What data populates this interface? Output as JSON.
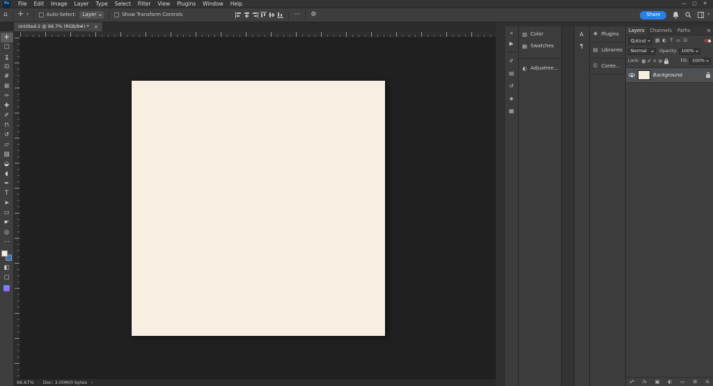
{
  "colors": {
    "accent": "#2680eb",
    "doc_fill": "#f7efe1",
    "fg_swatch": "#f7efe1",
    "bg_swatch": "#3e6db5",
    "ps_logo_bg": "#0b2a45",
    "ps_logo_text": "#55b1f5"
  },
  "menubar": {
    "logo": "Ps",
    "items": [
      "File",
      "Edit",
      "Image",
      "Layer",
      "Type",
      "Select",
      "Filter",
      "View",
      "Plugins",
      "Window",
      "Help"
    ],
    "window_controls": {
      "minimize": "—",
      "maximize": "▢",
      "close": "✕"
    }
  },
  "options_bar": {
    "home_icon": "⌂",
    "move_icon": "✛",
    "caret_icon": "▾",
    "auto_select_label": "Auto-Select:",
    "auto_select_value": "Layer",
    "show_transform_label": "Show Transform Controls",
    "ellipsis_icon": "⋯",
    "gear_icon": "⚙",
    "share_label": "Share",
    "align_icons": [
      {
        "name": "align-left-icon",
        "cls": "al-left"
      },
      {
        "name": "align-center-horizontal-icon",
        "cls": "al-ch"
      },
      {
        "name": "align-right-icon",
        "cls": "al-right"
      },
      {
        "name": "align-top-icon",
        "cls": "al-top"
      },
      {
        "name": "align-middle-vertical-icon",
        "cls": "al-mv"
      },
      {
        "name": "align-bottom-icon",
        "cls": "al-bottom"
      }
    ]
  },
  "document_tab": {
    "title": "Untitled-2 @ 66.7% (RGB/8#) *",
    "close_icon": "×"
  },
  "toolbar": {
    "tools": [
      {
        "name": "move-tool",
        "glyph": "✛",
        "active": true
      },
      {
        "name": "rectangular-marquee-tool",
        "glyph": "☐"
      },
      {
        "name": "lasso-tool",
        "glyph": "ʓ"
      },
      {
        "name": "object-selection-tool",
        "glyph": "⊡"
      },
      {
        "name": "crop-tool",
        "glyph": "#"
      },
      {
        "name": "frame-tool",
        "glyph": "⊠"
      },
      {
        "name": "eyedropper-tool",
        "glyph": "✑"
      },
      {
        "name": "spot-healing-brush-tool",
        "glyph": "✚"
      },
      {
        "name": "brush-tool",
        "glyph": "✐"
      },
      {
        "name": "clone-stamp-tool",
        "glyph": "⊓"
      },
      {
        "name": "history-brush-tool",
        "glyph": "↺"
      },
      {
        "name": "eraser-tool",
        "glyph": "▱"
      },
      {
        "name": "gradient-tool",
        "glyph": "▨"
      },
      {
        "name": "blur-tool",
        "glyph": "◒"
      },
      {
        "name": "dodge-tool",
        "glyph": "◖"
      },
      {
        "name": "pen-tool",
        "glyph": "✒"
      },
      {
        "name": "type-tool",
        "glyph": "T"
      },
      {
        "name": "path-selection-tool",
        "glyph": "➤"
      },
      {
        "name": "rectangle-tool",
        "glyph": "▭"
      },
      {
        "name": "hand-tool",
        "glyph": "☛"
      },
      {
        "name": "zoom-tool",
        "glyph": "◎"
      },
      {
        "name": "edit-toolbar-button",
        "glyph": "⋯"
      }
    ],
    "bottom_tools": [
      {
        "name": "quick-mask-button",
        "glyph": "◧"
      },
      {
        "name": "screen-mode-button",
        "glyph": "▢"
      }
    ]
  },
  "right_dock": {
    "strip_top": [
      {
        "name": "collapse-dock-icon",
        "glyph": "«"
      },
      {
        "name": "actions-panel-icon",
        "glyph": "▶"
      }
    ],
    "strip_group": [
      {
        "name": "brush-settings-panel-icon",
        "glyph": "✐"
      },
      {
        "name": "info-panel-icon",
        "glyph": "▤"
      },
      {
        "name": "history-panel-icon",
        "glyph": "↺"
      },
      {
        "name": "navigator-panel-icon",
        "glyph": "◈"
      },
      {
        "name": "timeline-panel-icon",
        "glyph": "▦"
      }
    ],
    "color_group": [
      {
        "name": "color-panel-button",
        "glyph": "▧",
        "label": "Color"
      },
      {
        "name": "swatches-panel-button",
        "glyph": "▦",
        "label": "Swatches"
      }
    ],
    "adjust_group": [
      {
        "name": "adjustments-panel-button",
        "glyph": "◐",
        "label": "Adjustme..."
      }
    ],
    "type_strip": [
      {
        "name": "character-panel-icon",
        "glyph": "A"
      },
      {
        "name": "paragraph-panel-icon",
        "glyph": "¶"
      }
    ],
    "library_group": [
      {
        "name": "plugins-panel-button",
        "glyph": "❖",
        "label": "Plugins"
      },
      {
        "name": "libraries-panel-button",
        "glyph": "▤",
        "label": "Libraries"
      },
      {
        "name": "content-credentials-panel-button",
        "glyph": "©",
        "label": "Conte..."
      }
    ]
  },
  "layers_panel": {
    "tabs": [
      {
        "name": "tab-layers",
        "label": "Layers",
        "active": true
      },
      {
        "name": "tab-channels",
        "label": "Channels"
      },
      {
        "name": "tab-paths",
        "label": "Paths"
      }
    ],
    "panel_menu_icon": "≡",
    "filter": {
      "kind_label": "Kind",
      "icons": [
        {
          "name": "filter-pixel-layers-icon",
          "glyph": "▦"
        },
        {
          "name": "filter-adjustment-layers-icon",
          "glyph": "◐"
        },
        {
          "name": "filter-type-layers-icon",
          "glyph": "T"
        },
        {
          "name": "filter-shape-layers-icon",
          "glyph": "▭"
        },
        {
          "name": "filter-smart-objects-icon",
          "glyph": "⊡"
        }
      ]
    },
    "blend_mode": "Normal",
    "opacity_label": "Opacity:",
    "opacity_value": "100%",
    "lock_label": "Lock:",
    "lock_icons": [
      {
        "name": "lock-transparency-icon",
        "glyph": "▦"
      },
      {
        "name": "lock-pixels-icon",
        "glyph": "✐"
      },
      {
        "name": "lock-position-icon",
        "glyph": "✛"
      },
      {
        "name": "lock-artboard-icon",
        "glyph": "⊞"
      }
    ],
    "fill_label": "Fill:",
    "fill_value": "100%",
    "layers": [
      {
        "name": "Background"
      }
    ],
    "bottom_icons": [
      {
        "name": "link-layers-icon",
        "glyph": "☍"
      },
      {
        "name": "layer-effects-icon",
        "glyph": "fx",
        "cls": "fx"
      },
      {
        "name": "add-layer-mask-icon",
        "glyph": "▣"
      },
      {
        "name": "new-adjustment-layer-icon",
        "glyph": "◐"
      },
      {
        "name": "new-group-icon",
        "glyph": "▭"
      },
      {
        "name": "new-layer-icon",
        "glyph": "⊞"
      },
      {
        "name": "delete-layer-icon",
        "glyph": "⊖"
      }
    ]
  },
  "status_bar": {
    "zoom": "66.67%",
    "doc_info": "Doc: 3.00M/0 bytes",
    "chevron_icon": "›"
  }
}
